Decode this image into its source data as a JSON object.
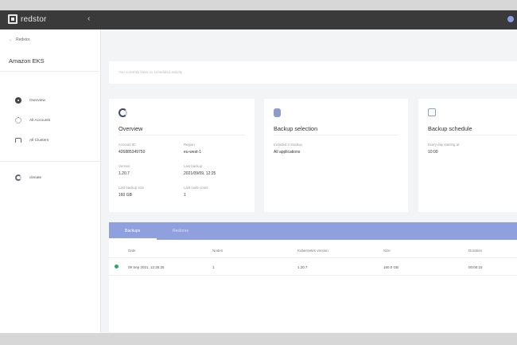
{
  "app": {
    "logo_text": "redstor"
  },
  "sidebar": {
    "back_label": "Redstor",
    "title": "Amazon EKS",
    "items": [
      {
        "label": "Overview",
        "icon": "overview-icon"
      },
      {
        "label": "All Accounts",
        "icon": "accounts-icon"
      },
      {
        "label": "All Clusters",
        "icon": "clusters-icon"
      }
    ],
    "cluster": {
      "label": "climate",
      "icon": "cluster-status-icon"
    }
  },
  "notice": "You currently have no scheduled activity",
  "overview": {
    "title": "Overview",
    "icon": "overview-ring-icon",
    "fields": [
      {
        "label": "Account ID",
        "value": "426885349750"
      },
      {
        "label": "Region",
        "value": "eu-west-1"
      },
      {
        "label": "Version",
        "value": "1.20.7"
      },
      {
        "label": "Last backup",
        "value": "2021/09/09, 12:25"
      },
      {
        "label": "Last backup size",
        "value": "160 GB"
      },
      {
        "label": "Last node count",
        "value": "1"
      }
    ]
  },
  "backup_selection": {
    "title": "Backup selection",
    "icon": "database-icon",
    "field_label": "Included in backup",
    "field_value": "All applications"
  },
  "backup_schedule": {
    "title": "Backup schedule",
    "icon": "calendar-icon",
    "field_label": "Every day starting at",
    "field_value": "10:00"
  },
  "panel": {
    "tabs": [
      "Backups",
      "Restores"
    ],
    "columns": [
      "Date",
      "Nodes",
      "Kubernetes version",
      "Size",
      "Duration"
    ],
    "rows": [
      {
        "date": "09 Sep 2021, 12:25:25",
        "nodes": "1",
        "version": "1.20.7",
        "size": "160.0 GB",
        "duration": "00:00:15",
        "status_color": "#2ca870"
      }
    ]
  }
}
